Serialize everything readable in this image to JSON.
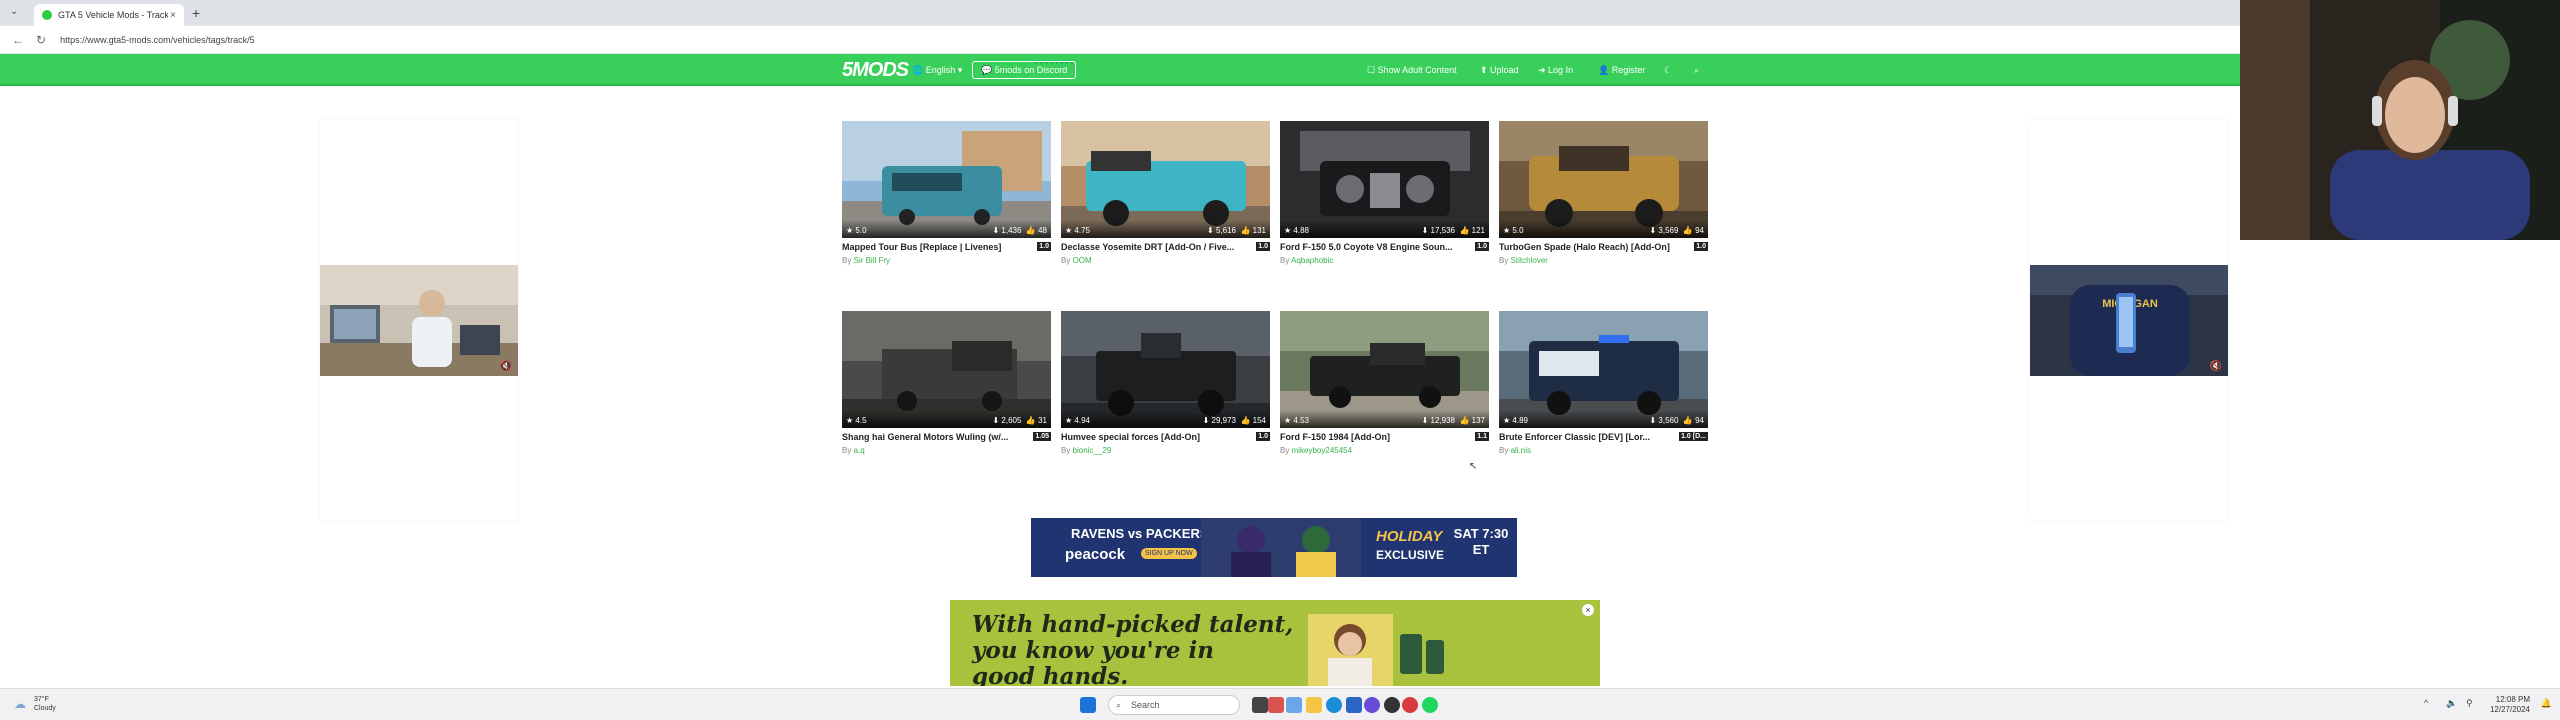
{
  "browser": {
    "tab_title": "GTA 5 Vehicle Mods - Track - GTA 5",
    "url": "https://www.gta5-mods.com/vehicles/tags/track/5"
  },
  "header": {
    "logo": "5MODS",
    "language": "English",
    "discord": "5mods on Discord",
    "show_adult": "Show Adult Content",
    "upload": "Upload",
    "login": "Log In",
    "register": "Register"
  },
  "mods": [
    {
      "title": "Mapped Tour Bus [Replace | Livenes]",
      "version": "1.0",
      "author": "Sir Bill Fry",
      "rating": "5.0",
      "downloads": "1,436",
      "likes": "48"
    },
    {
      "title": "Declasse Yosemite DRT [Add-On / Five...",
      "version": "1.0",
      "author": "OOM",
      "rating": "4.75",
      "downloads": "5,616",
      "likes": "131"
    },
    {
      "title": "Ford F-150 5.0 Coyote V8 Engine Soun...",
      "version": "1.0",
      "author": "Aqbaphobic",
      "rating": "4.88",
      "downloads": "17,536",
      "likes": "121"
    },
    {
      "title": "TurboGen Spade (Halo Reach) [Add-On]",
      "version": "1.0",
      "author": "Stitchlover",
      "rating": "5.0",
      "downloads": "3,569",
      "likes": "94"
    },
    {
      "title": "Shang hai General Motors Wuling (w/...",
      "version": "1.05",
      "author": "a.q",
      "rating": "4.5",
      "downloads": "2,605",
      "likes": "31"
    },
    {
      "title": "Humvee special forces [Add-On]",
      "version": "1.0",
      "author": "bionic__29",
      "rating": "4.94",
      "downloads": "29,973",
      "likes": "154"
    },
    {
      "title": "Ford F-150 1984 [Add-On]",
      "version": "1.1",
      "author": "mikeyboy245454",
      "rating": "4.53",
      "downloads": "12,938",
      "likes": "137"
    },
    {
      "title": "Brute Enforcer Classic [DEV] [Lor...",
      "version": "1.0 [D...",
      "author": "ali.nis",
      "rating": "4.89",
      "downloads": "3,560",
      "likes": "94"
    }
  ],
  "by_label": "By",
  "banner1": {
    "headline": "RAVENS vs PACKERS",
    "brand": "peacock",
    "badge": "HOLIDAY",
    "badge2": "EXCLUSIVE",
    "time": "SAT 7:30 ET",
    "cta": "SIGN UP NOW"
  },
  "banner2": {
    "line1": "With hand-picked talent,",
    "line2": "you know you're in",
    "line3": "good hands."
  },
  "taskbar": {
    "search": "Search",
    "time": "12:08 PM",
    "date": "12/27/2024",
    "temp": "37°F",
    "weather": "Cloudy"
  },
  "colors": {
    "brand": "#38d05a",
    "banner_green": "#a9c23e",
    "ad_navy": "#1f3470"
  }
}
